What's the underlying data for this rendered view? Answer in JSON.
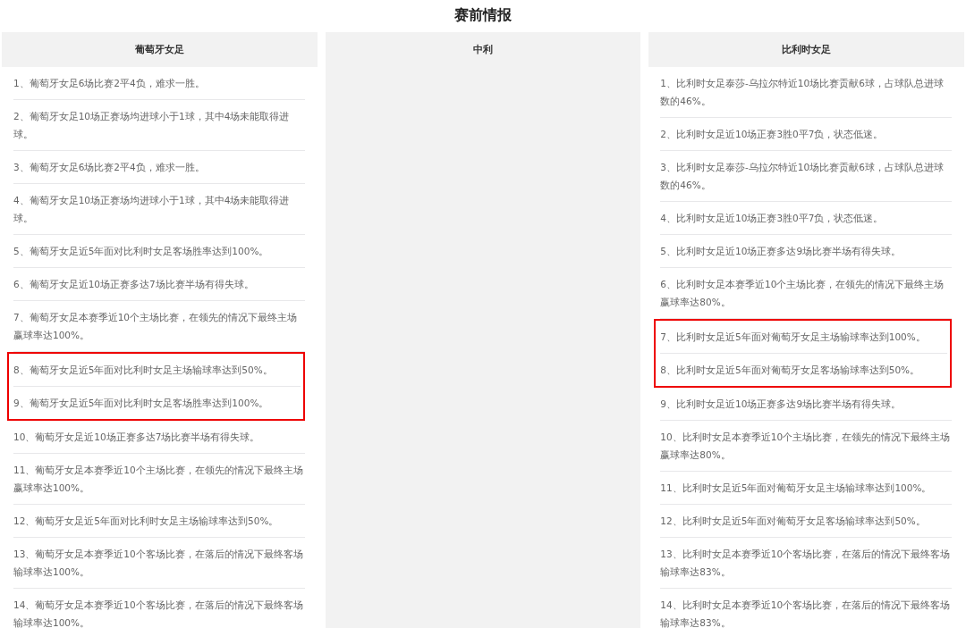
{
  "title": "赛前情报",
  "columns": [
    {
      "heading": "葡萄牙女足",
      "items": [
        {
          "text": "1、葡萄牙女足6场比赛2平4负，难求一胜。",
          "highlighted": false
        },
        {
          "text": "2、葡萄牙女足10场正赛场均进球小于1球，其中4场未能取得进球。",
          "highlighted": false
        },
        {
          "text": "3、葡萄牙女足6场比赛2平4负，难求一胜。",
          "highlighted": false
        },
        {
          "text": "4、葡萄牙女足10场正赛场均进球小于1球，其中4场未能取得进球。",
          "highlighted": false
        },
        {
          "text": "5、葡萄牙女足近5年面对比利时女足客场胜率达到100%。",
          "highlighted": false
        },
        {
          "text": "6、葡萄牙女足近10场正赛多达7场比赛半场有得失球。",
          "highlighted": false
        },
        {
          "text": "7、葡萄牙女足本赛季近10个主场比赛，在领先的情况下最终主场赢球率达100%。",
          "highlighted": false
        },
        {
          "text": "8、葡萄牙女足近5年面对比利时女足主场输球率达到50%。",
          "highlighted": true
        },
        {
          "text": "9、葡萄牙女足近5年面对比利时女足客场胜率达到100%。",
          "highlighted": true
        },
        {
          "text": "10、葡萄牙女足近10场正赛多达7场比赛半场有得失球。",
          "highlighted": false
        },
        {
          "text": "11、葡萄牙女足本赛季近10个主场比赛，在领先的情况下最终主场赢球率达100%。",
          "highlighted": false
        },
        {
          "text": "12、葡萄牙女足近5年面对比利时女足主场输球率达到50%。",
          "highlighted": false
        },
        {
          "text": "13、葡萄牙女足本赛季近10个客场比赛，在落后的情况下最终客场输球率达100%。",
          "highlighted": false
        },
        {
          "text": "14、葡萄牙女足本赛季近10个客场比赛，在落后的情况下最终客场输球率达100%。",
          "highlighted": false
        }
      ]
    },
    {
      "heading": "中利"
    },
    {
      "heading": "比利时女足",
      "items": [
        {
          "text": "1、比利时女足泰莎-乌拉尔特近10场比赛贡献6球，占球队总进球数的46%。",
          "highlighted": false
        },
        {
          "text": "2、比利时女足近10场正赛3胜0平7负，状态低迷。",
          "highlighted": false
        },
        {
          "text": "3、比利时女足泰莎-乌拉尔特近10场比赛贡献6球，占球队总进球数的46%。",
          "highlighted": false
        },
        {
          "text": "4、比利时女足近10场正赛3胜0平7负，状态低迷。",
          "highlighted": false
        },
        {
          "text": "5、比利时女足近10场正赛多达9场比赛半场有得失球。",
          "highlighted": false
        },
        {
          "text": "6、比利时女足本赛季近10个主场比赛，在领先的情况下最终主场赢球率达80%。",
          "highlighted": false
        },
        {
          "text": "7、比利时女足近5年面对葡萄牙女足主场输球率达到100%。",
          "highlighted": true
        },
        {
          "text": "8、比利时女足近5年面对葡萄牙女足客场输球率达到50%。",
          "highlighted": true
        },
        {
          "text": "9、比利时女足近10场正赛多达9场比赛半场有得失球。",
          "highlighted": false
        },
        {
          "text": "10、比利时女足本赛季近10个主场比赛，在领先的情况下最终主场赢球率达80%。",
          "highlighted": false
        },
        {
          "text": "11、比利时女足近5年面对葡萄牙女足主场输球率达到100%。",
          "highlighted": false
        },
        {
          "text": "12、比利时女足近5年面对葡萄牙女足客场输球率达到50%。",
          "highlighted": false
        },
        {
          "text": "13、比利时女足本赛季近10个客场比赛，在落后的情况下最终客场输球率达83%。",
          "highlighted": false
        },
        {
          "text": "14、比利时女足本赛季近10个客场比赛，在落后的情况下最终客场输球率达83%。",
          "highlighted": false
        }
      ]
    }
  ]
}
